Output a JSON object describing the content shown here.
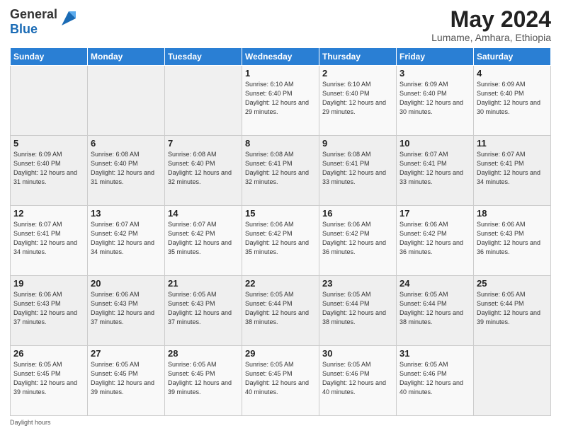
{
  "header": {
    "logo_general": "General",
    "logo_blue": "Blue",
    "month_year": "May 2024",
    "location": "Lumame, Amhara, Ethiopia"
  },
  "days_of_week": [
    "Sunday",
    "Monday",
    "Tuesday",
    "Wednesday",
    "Thursday",
    "Friday",
    "Saturday"
  ],
  "weeks": [
    [
      {
        "day": "",
        "sunrise": "",
        "sunset": "",
        "daylight": ""
      },
      {
        "day": "",
        "sunrise": "",
        "sunset": "",
        "daylight": ""
      },
      {
        "day": "",
        "sunrise": "",
        "sunset": "",
        "daylight": ""
      },
      {
        "day": "1",
        "sunrise": "Sunrise: 6:10 AM",
        "sunset": "Sunset: 6:40 PM",
        "daylight": "Daylight: 12 hours and 29 minutes."
      },
      {
        "day": "2",
        "sunrise": "Sunrise: 6:10 AM",
        "sunset": "Sunset: 6:40 PM",
        "daylight": "Daylight: 12 hours and 29 minutes."
      },
      {
        "day": "3",
        "sunrise": "Sunrise: 6:09 AM",
        "sunset": "Sunset: 6:40 PM",
        "daylight": "Daylight: 12 hours and 30 minutes."
      },
      {
        "day": "4",
        "sunrise": "Sunrise: 6:09 AM",
        "sunset": "Sunset: 6:40 PM",
        "daylight": "Daylight: 12 hours and 30 minutes."
      }
    ],
    [
      {
        "day": "5",
        "sunrise": "Sunrise: 6:09 AM",
        "sunset": "Sunset: 6:40 PM",
        "daylight": "Daylight: 12 hours and 31 minutes."
      },
      {
        "day": "6",
        "sunrise": "Sunrise: 6:08 AM",
        "sunset": "Sunset: 6:40 PM",
        "daylight": "Daylight: 12 hours and 31 minutes."
      },
      {
        "day": "7",
        "sunrise": "Sunrise: 6:08 AM",
        "sunset": "Sunset: 6:40 PM",
        "daylight": "Daylight: 12 hours and 32 minutes."
      },
      {
        "day": "8",
        "sunrise": "Sunrise: 6:08 AM",
        "sunset": "Sunset: 6:41 PM",
        "daylight": "Daylight: 12 hours and 32 minutes."
      },
      {
        "day": "9",
        "sunrise": "Sunrise: 6:08 AM",
        "sunset": "Sunset: 6:41 PM",
        "daylight": "Daylight: 12 hours and 33 minutes."
      },
      {
        "day": "10",
        "sunrise": "Sunrise: 6:07 AM",
        "sunset": "Sunset: 6:41 PM",
        "daylight": "Daylight: 12 hours and 33 minutes."
      },
      {
        "day": "11",
        "sunrise": "Sunrise: 6:07 AM",
        "sunset": "Sunset: 6:41 PM",
        "daylight": "Daylight: 12 hours and 34 minutes."
      }
    ],
    [
      {
        "day": "12",
        "sunrise": "Sunrise: 6:07 AM",
        "sunset": "Sunset: 6:41 PM",
        "daylight": "Daylight: 12 hours and 34 minutes."
      },
      {
        "day": "13",
        "sunrise": "Sunrise: 6:07 AM",
        "sunset": "Sunset: 6:42 PM",
        "daylight": "Daylight: 12 hours and 34 minutes."
      },
      {
        "day": "14",
        "sunrise": "Sunrise: 6:07 AM",
        "sunset": "Sunset: 6:42 PM",
        "daylight": "Daylight: 12 hours and 35 minutes."
      },
      {
        "day": "15",
        "sunrise": "Sunrise: 6:06 AM",
        "sunset": "Sunset: 6:42 PM",
        "daylight": "Daylight: 12 hours and 35 minutes."
      },
      {
        "day": "16",
        "sunrise": "Sunrise: 6:06 AM",
        "sunset": "Sunset: 6:42 PM",
        "daylight": "Daylight: 12 hours and 36 minutes."
      },
      {
        "day": "17",
        "sunrise": "Sunrise: 6:06 AM",
        "sunset": "Sunset: 6:42 PM",
        "daylight": "Daylight: 12 hours and 36 minutes."
      },
      {
        "day": "18",
        "sunrise": "Sunrise: 6:06 AM",
        "sunset": "Sunset: 6:43 PM",
        "daylight": "Daylight: 12 hours and 36 minutes."
      }
    ],
    [
      {
        "day": "19",
        "sunrise": "Sunrise: 6:06 AM",
        "sunset": "Sunset: 6:43 PM",
        "daylight": "Daylight: 12 hours and 37 minutes."
      },
      {
        "day": "20",
        "sunrise": "Sunrise: 6:06 AM",
        "sunset": "Sunset: 6:43 PM",
        "daylight": "Daylight: 12 hours and 37 minutes."
      },
      {
        "day": "21",
        "sunrise": "Sunrise: 6:05 AM",
        "sunset": "Sunset: 6:43 PM",
        "daylight": "Daylight: 12 hours and 37 minutes."
      },
      {
        "day": "22",
        "sunrise": "Sunrise: 6:05 AM",
        "sunset": "Sunset: 6:44 PM",
        "daylight": "Daylight: 12 hours and 38 minutes."
      },
      {
        "day": "23",
        "sunrise": "Sunrise: 6:05 AM",
        "sunset": "Sunset: 6:44 PM",
        "daylight": "Daylight: 12 hours and 38 minutes."
      },
      {
        "day": "24",
        "sunrise": "Sunrise: 6:05 AM",
        "sunset": "Sunset: 6:44 PM",
        "daylight": "Daylight: 12 hours and 38 minutes."
      },
      {
        "day": "25",
        "sunrise": "Sunrise: 6:05 AM",
        "sunset": "Sunset: 6:44 PM",
        "daylight": "Daylight: 12 hours and 39 minutes."
      }
    ],
    [
      {
        "day": "26",
        "sunrise": "Sunrise: 6:05 AM",
        "sunset": "Sunset: 6:45 PM",
        "daylight": "Daylight: 12 hours and 39 minutes."
      },
      {
        "day": "27",
        "sunrise": "Sunrise: 6:05 AM",
        "sunset": "Sunset: 6:45 PM",
        "daylight": "Daylight: 12 hours and 39 minutes."
      },
      {
        "day": "28",
        "sunrise": "Sunrise: 6:05 AM",
        "sunset": "Sunset: 6:45 PM",
        "daylight": "Daylight: 12 hours and 39 minutes."
      },
      {
        "day": "29",
        "sunrise": "Sunrise: 6:05 AM",
        "sunset": "Sunset: 6:45 PM",
        "daylight": "Daylight: 12 hours and 40 minutes."
      },
      {
        "day": "30",
        "sunrise": "Sunrise: 6:05 AM",
        "sunset": "Sunset: 6:46 PM",
        "daylight": "Daylight: 12 hours and 40 minutes."
      },
      {
        "day": "31",
        "sunrise": "Sunrise: 6:05 AM",
        "sunset": "Sunset: 6:46 PM",
        "daylight": "Daylight: 12 hours and 40 minutes."
      },
      {
        "day": "",
        "sunrise": "",
        "sunset": "",
        "daylight": ""
      }
    ]
  ],
  "footer": {
    "daylight_label": "Daylight hours"
  }
}
